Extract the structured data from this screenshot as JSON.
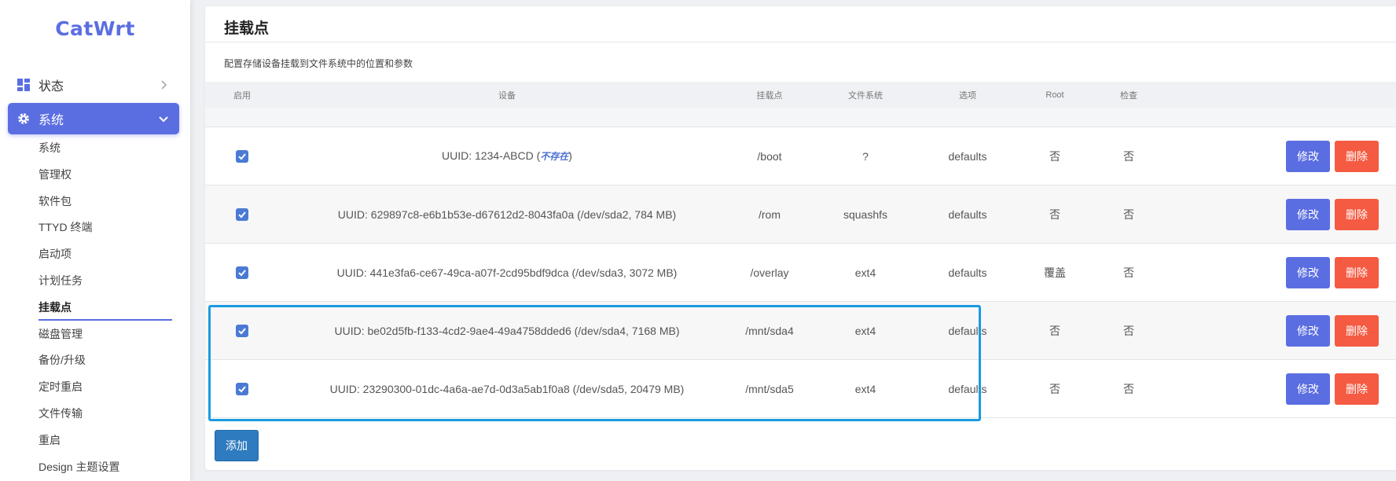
{
  "app": {
    "logo": "CatWrt"
  },
  "sidebar": {
    "status_label": "状态",
    "system_label": "系统",
    "items": [
      {
        "label": "系统"
      },
      {
        "label": "管理权"
      },
      {
        "label": "软件包"
      },
      {
        "label": "TTYD 终端"
      },
      {
        "label": "启动项"
      },
      {
        "label": "计划任务"
      },
      {
        "label": "挂载点"
      },
      {
        "label": "磁盘管理"
      },
      {
        "label": "备份/升级"
      },
      {
        "label": "定时重启"
      },
      {
        "label": "文件传输"
      },
      {
        "label": "重启"
      },
      {
        "label": "Design 主题设置"
      }
    ],
    "active_item": "挂载点"
  },
  "page": {
    "title": "挂载点",
    "description": "配置存储设备挂载到文件系统中的位置和参数",
    "add_label": "添加"
  },
  "table": {
    "headers": {
      "enabled": "启用",
      "device": "设备",
      "mountpoint": "挂载点",
      "filesystem": "文件系统",
      "options": "选项",
      "root": "Root",
      "check": "检查"
    },
    "rows": [
      {
        "enabled": true,
        "device": "UUID: 1234-ABCD (",
        "device_note": "不存在",
        "device_suffix": ")",
        "mountpoint": "/boot",
        "filesystem": "?",
        "options": "defaults",
        "root": "否",
        "check": "否"
      },
      {
        "enabled": true,
        "device": "UUID: 629897c8-e6b1b53e-d67612d2-8043fa0a (/dev/sda2, 784 MB)",
        "mountpoint": "/rom",
        "filesystem": "squashfs",
        "options": "defaults",
        "root": "否",
        "check": "否"
      },
      {
        "enabled": true,
        "device": "UUID: 441e3fa6-ce67-49ca-a07f-2cd95bdf9dca (/dev/sda3, 3072 MB)",
        "mountpoint": "/overlay",
        "filesystem": "ext4",
        "options": "defaults",
        "root": "覆盖",
        "check": "否"
      },
      {
        "enabled": true,
        "device": "UUID: be02d5fb-f133-4cd2-9ae4-49a4758dded6 (/dev/sda4, 7168 MB)",
        "mountpoint": "/mnt/sda4",
        "filesystem": "ext4",
        "options": "defaults",
        "root": "否",
        "check": "否"
      },
      {
        "enabled": true,
        "device": "UUID: 23290300-01dc-4a6a-ae7d-0d3a5ab1f0a8 (/dev/sda5, 20479 MB)",
        "mountpoint": "/mnt/sda5",
        "filesystem": "ext4",
        "options": "defaults",
        "root": "否",
        "check": "否"
      }
    ],
    "actions": {
      "edit": "修改",
      "delete": "删除"
    }
  },
  "colors": {
    "accent": "#5b6ee1",
    "delete": "#f55b42",
    "add": "#2f7bbf",
    "highlight": "#1a9be0"
  }
}
